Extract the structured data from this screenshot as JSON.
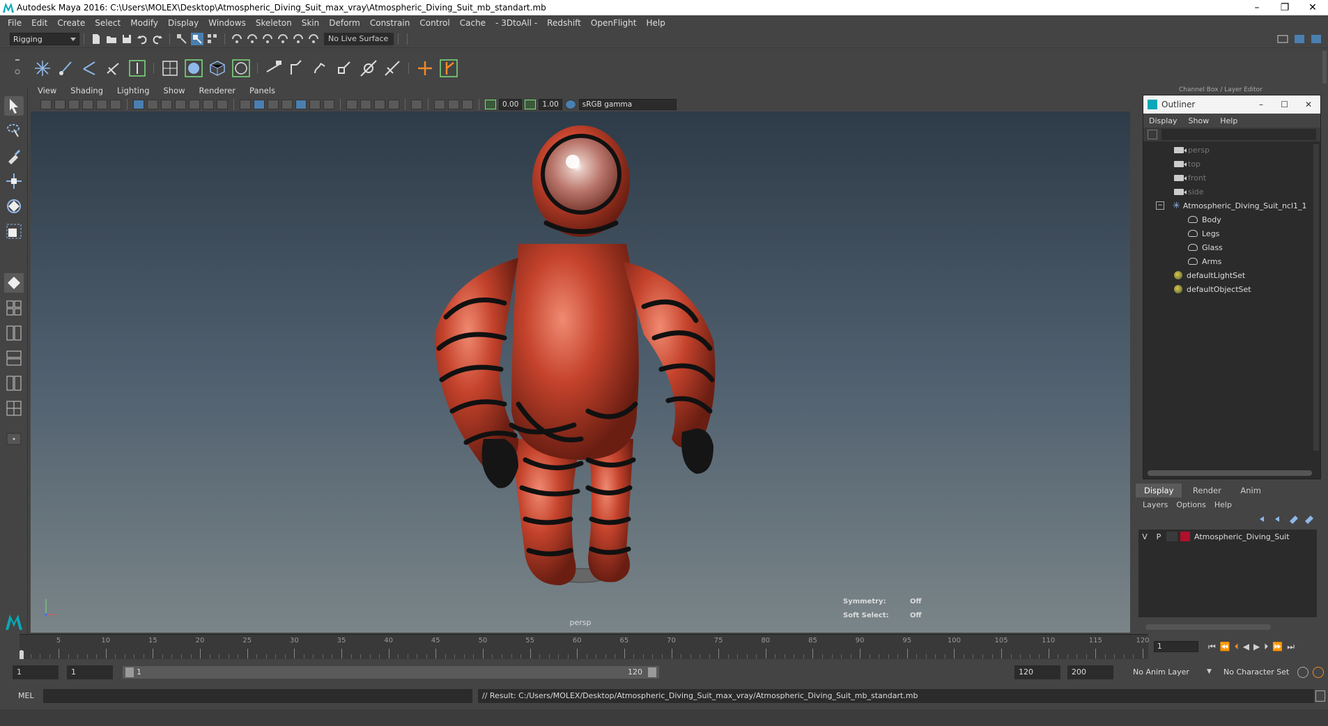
{
  "title_bar": {
    "text": "Autodesk Maya 2016: C:\\Users\\MOLEX\\Desktop\\Atmospheric_Diving_Suit_max_vray\\Atmospheric_Diving_Suit_mb_standart.mb"
  },
  "menubar": [
    "File",
    "Edit",
    "Create",
    "Select",
    "Modify",
    "Display",
    "Windows",
    "Skeleton",
    "Skin",
    "Deform",
    "Constrain",
    "Control",
    "Cache",
    "- 3DtoAll -",
    "Redshift",
    "OpenFlight",
    "Help"
  ],
  "statusline": {
    "mode": "Rigging",
    "live_surface": "No Live Surface"
  },
  "panel_menu": [
    "View",
    "Shading",
    "Lighting",
    "Show",
    "Renderer",
    "Panels"
  ],
  "panel_toolbar": {
    "exposure": "0.00",
    "gamma": "1.00",
    "color_space": "sRGB gamma"
  },
  "viewport": {
    "camera_label": "persp",
    "hud": {
      "symmetry_label": "Symmetry:",
      "symmetry_value": "Off",
      "softselect_label": "Soft Select:",
      "softselect_value": "Off"
    }
  },
  "channel_box_title": "Channel Box / Layer Editor",
  "outliner": {
    "title": "Outliner",
    "menu": [
      "Display",
      "Show",
      "Help"
    ],
    "items": [
      {
        "label": "persp"
      },
      {
        "label": "top"
      },
      {
        "label": "front"
      },
      {
        "label": "side"
      },
      {
        "label": "Atmospheric_Diving_Suit_ncl1_1"
      },
      {
        "label": "Body"
      },
      {
        "label": "Legs"
      },
      {
        "label": "Glass"
      },
      {
        "label": "Arms"
      },
      {
        "label": "defaultLightSet"
      },
      {
        "label": "defaultObjectSet"
      }
    ]
  },
  "layer_editor": {
    "tabs": [
      "Display",
      "Render",
      "Anim"
    ],
    "menu": [
      "Layers",
      "Options",
      "Help"
    ],
    "layer": {
      "v": "V",
      "p": "P",
      "name": "Atmospheric_Diving_Suit",
      "color": "#b0102a"
    }
  },
  "timeline": {
    "ticks": [
      "5",
      "10",
      "15",
      "20",
      "25",
      "30",
      "35",
      "40",
      "45",
      "50",
      "55",
      "60",
      "65",
      "70",
      "75",
      "80",
      "85",
      "90",
      "95",
      "100",
      "105",
      "110",
      "115",
      "120"
    ],
    "start_frame": "1",
    "current_frame": "1"
  },
  "range": {
    "start": "1",
    "anim_start": "1",
    "slider_start": "1",
    "slider_end": "120",
    "end": "120",
    "anim_end": "200",
    "anim_layer": "No Anim Layer",
    "character_set": "No Character Set"
  },
  "command_line": {
    "lang": "MEL",
    "result": "// Result: C:/Users/MOLEX/Desktop/Atmospheric_Diving_Suit_max_vray/Atmospheric_Diving_Suit_mb_standart.mb"
  },
  "colors": {
    "suit": "#c5432c",
    "bands": "#111111",
    "accent": "#0aa8b8"
  }
}
